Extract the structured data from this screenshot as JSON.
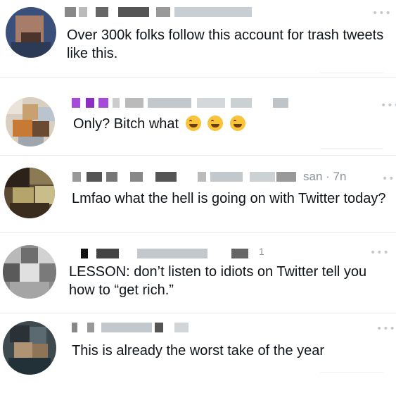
{
  "tweets": [
    {
      "text": "Over 300k folks follow this account for trash tweets like this.",
      "more_icon": "more-horizontal-icon"
    },
    {
      "text": "Only? Bitch what",
      "emoji": [
        "rolling-on-floor-laughing",
        "rolling-on-floor-laughing",
        "rolling-on-floor-laughing"
      ],
      "more_icon": "more-horizontal-icon"
    },
    {
      "text": "Lmfao what the hell is going on with Twitter today?",
      "meta_tail": "san · 7n",
      "more_icon": "more-horizontal-icon"
    },
    {
      "text": "LESSON: don’t listen to idiots on Twitter tell you how to “get rich.”",
      "meta_tail": "1",
      "more_icon": "more-horizontal-icon"
    },
    {
      "text": "This is already the worst take of the year",
      "more_icon": "more-horizontal-icon"
    }
  ],
  "colors": {
    "text": "#0f1419",
    "icon": "#c3c8cc",
    "divider": "#e7eaec",
    "purple_blur": "#a64ad8"
  }
}
